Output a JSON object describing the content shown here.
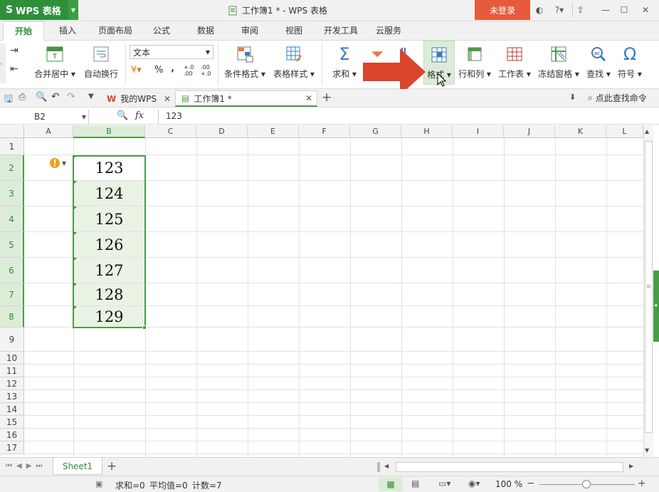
{
  "app": {
    "name": "WPS 表格",
    "window_title": "工作簿1 * - WPS 表格",
    "login_label": "未登录",
    "help_label": "?"
  },
  "menu_tabs": [
    "开始",
    "插入",
    "页面布局",
    "公式",
    "数据",
    "审阅",
    "视图",
    "开发工具",
    "云服务"
  ],
  "ribbon": {
    "merge_center": "合并居中",
    "auto_wrap": "自动换行",
    "number_format": "文本",
    "percent": "%",
    "thousands": "‚",
    "conditional_format": "条件格式",
    "table_style": "表格样式",
    "sum": "求和",
    "format": "格式",
    "row_col": "行和列",
    "worksheet": "工作表",
    "freeze": "冻结窗格",
    "find": "查找",
    "symbol": "符号"
  },
  "doc_tabs": {
    "my_wps": "我的WPS",
    "workbook": "工作簿1 *",
    "search_cmd": "点此查找命令"
  },
  "formula_bar": {
    "name_box": "B2",
    "fx": "fx",
    "value": "123"
  },
  "grid": {
    "columns": [
      "A",
      "B",
      "C",
      "D",
      "E",
      "F",
      "G",
      "H",
      "I",
      "J",
      "K",
      "L"
    ],
    "selected_column": "B",
    "rows": [
      "1",
      "2",
      "3",
      "4",
      "5",
      "6",
      "7",
      "8",
      "9",
      "10",
      "11",
      "12",
      "13",
      "14",
      "15",
      "16",
      "17"
    ],
    "cells_b": [
      "123",
      "124",
      "125",
      "126",
      "127",
      "128",
      "129"
    ]
  },
  "sheet_tab": "Sheet1",
  "status": {
    "sum": "求和=0",
    "average": "平均值=0",
    "count": "计数=7",
    "zoom": "100 %"
  },
  "colors": {
    "accent_green": "#2f8f3a",
    "login_red": "#e85a3c",
    "selection_green": "#4a9c45",
    "arrow_red": "#d9462b"
  }
}
